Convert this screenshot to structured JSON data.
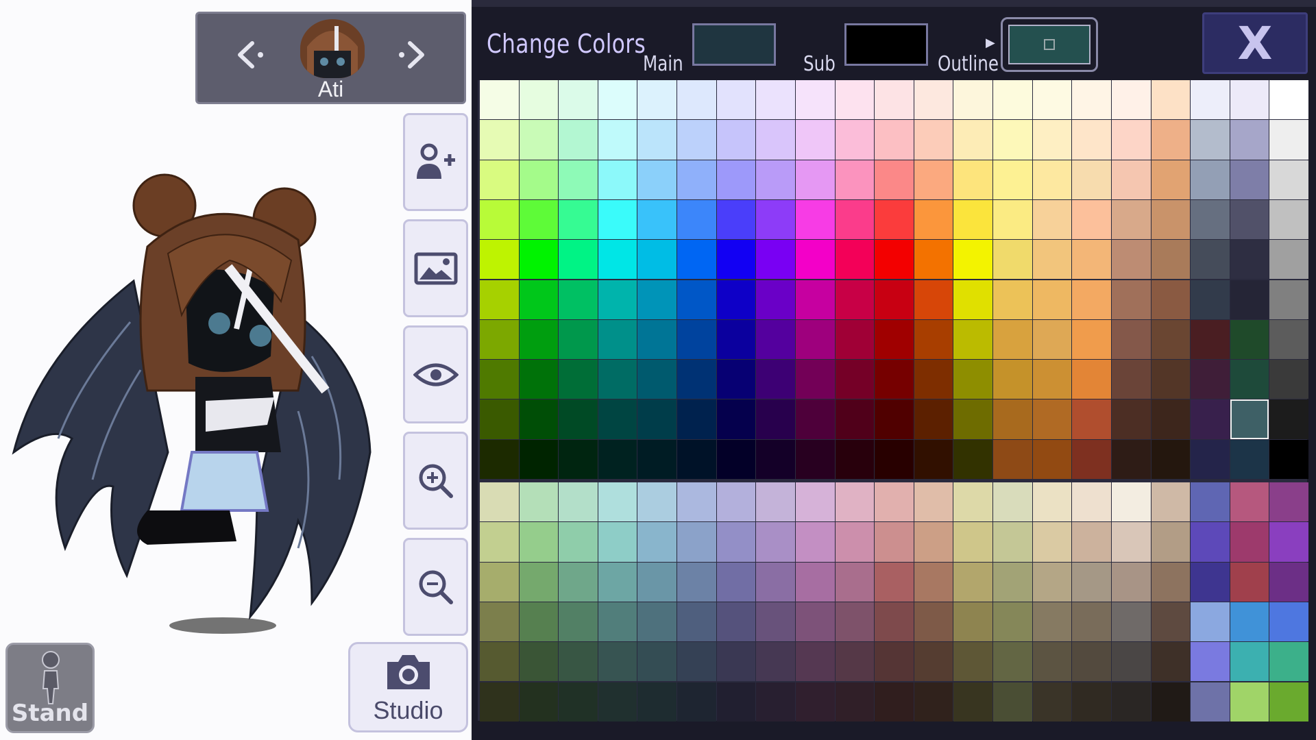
{
  "character": {
    "name": "Ati"
  },
  "panel": {
    "title": "Change Colors",
    "main_label": "Main",
    "sub_label": "Sub",
    "outline_label": "Outline",
    "close_label": "X",
    "main_color": "#1f3540",
    "sub_color": "#000000",
    "outline_color": "#24504f"
  },
  "buttons": {
    "stand_label": "Stand",
    "studio_label": "Studio"
  },
  "palette": {
    "top_grid": [
      [
        "#f5fde6",
        "#e6fde0",
        "#dbfbe9",
        "#dcfdfc",
        "#dcf2fd",
        "#dde8fd",
        "#e2e2fd",
        "#ebe2fd",
        "#f6e3fb",
        "#fde2ef",
        "#fde3e5",
        "#fde8df",
        "#fdf6dc",
        "#fdfbdd",
        "#fefae3",
        "#fff5e6",
        "#fff1e8",
        "#fde1c6",
        "#edeefa",
        "#edeaf9",
        "#ffffff"
      ],
      [
        "#e6fbb4",
        "#c9fbb7",
        "#b3f7d2",
        "#bffafb",
        "#bbe4fb",
        "#bcd1fb",
        "#c6c4fb",
        "#d9c5fb",
        "#efc6f8",
        "#fbbdd9",
        "#fcbfc3",
        "#fcccb9",
        "#fdecb6",
        "#fdf8b9",
        "#feefc3",
        "#fee5c9",
        "#fdd5c7",
        "#eeb088",
        "#b3bccc",
        "#a6a6c9",
        "#eeeeee"
      ],
      [
        "#d9fb80",
        "#a4fb8a",
        "#8efab7",
        "#8cf9fa",
        "#8bd0fa",
        "#8fb0fa",
        "#9d99fa",
        "#b99bf8",
        "#e598f3",
        "#fb93be",
        "#fb8888",
        "#fba97f",
        "#fde47c",
        "#fdf193",
        "#fde8a0",
        "#f7dcae",
        "#f5c6b0",
        "#e1a372",
        "#939fb5",
        "#7e7ea8",
        "#d8d8d8"
      ],
      [
        "#b8fb38",
        "#5efb38",
        "#36fb93",
        "#3afbfa",
        "#39c2fa",
        "#3c86fa",
        "#4a3efa",
        "#8d3cf8",
        "#f73ce5",
        "#fb3c8b",
        "#fb3c3c",
        "#fb963c",
        "#fbe43c",
        "#fbeb83",
        "#f7d199",
        "#fcc09b",
        "#d8a98a",
        "#c9936a",
        "#666f80",
        "#515169",
        "#c0c0c0"
      ],
      [
        "#bef301",
        "#00f300",
        "#00f385",
        "#00e6e6",
        "#00bde5",
        "#0066f3",
        "#1200f3",
        "#7900f3",
        "#f300c8",
        "#f30058",
        "#f30000",
        "#f37200",
        "#f3f300",
        "#f0da6b",
        "#f2c57c",
        "#f3b677",
        "#bd8c73",
        "#a97b5a",
        "#454c5a",
        "#2e2e42",
        "#a0a0a0"
      ],
      [
        "#a6d100",
        "#00c71a",
        "#00c063",
        "#00b4ac",
        "#0094b8",
        "#0057c7",
        "#0e00c7",
        "#6a00c7",
        "#c600a0",
        "#c80046",
        "#c80012",
        "#d74608",
        "#e0e000",
        "#ecc258",
        "#eeb862",
        "#f3a962",
        "#a0705a",
        "#8a5a42",
        "#323b4b",
        "#252536",
        "#808080"
      ],
      [
        "#7ca800",
        "#009e0f",
        "#00984c",
        "#00908a",
        "#007596",
        "#00439e",
        "#0b009e",
        "#54009e",
        "#9e007d",
        "#a00036",
        "#a00000",
        "#a83e00",
        "#bbbb00",
        "#d8a23e",
        "#dea855",
        "#f09c4c",
        "#84584a",
        "#6a4632",
        "#4a1e22",
        "#1f4a2a",
        "#5c5c5c"
      ],
      [
        "#4f7a00",
        "#007209",
        "#006e37",
        "#006c64",
        "#005a6e",
        "#003274",
        "#070073",
        "#3d0074",
        "#730057",
        "#750027",
        "#760000",
        "#7e2e00",
        "#8e8e00",
        "#c5922a",
        "#cc9033",
        "#e38536",
        "#6a4438",
        "#533627",
        "#3f1e38",
        "#1e4a3a",
        "#3a3a3a"
      ],
      [
        "#3a5a00",
        "#004e06",
        "#004a25",
        "#004542",
        "#003d4a",
        "#00224e",
        "#05004d",
        "#28004d",
        "#4e003a",
        "#50001a",
        "#500000",
        "#5c2000",
        "#6e6c00",
        "#a86a1e",
        "#b06a24",
        "#b04e2e",
        "#4c2e24",
        "#3d261c",
        "#38204c",
        "#3e6066",
        "#1c1c1c"
      ],
      [
        "#1c2a00",
        "#002400",
        "#002510",
        "#002220",
        "#001c24",
        "#001228",
        "#030028",
        "#140028",
        "#280020",
        "#28000c",
        "#280000",
        "#311000",
        "#323200",
        "#8e4a16",
        "#924a12",
        "#7e3020",
        "#2e1c16",
        "#24170e",
        "#24244a",
        "#1c3448",
        "#000000"
      ]
    ],
    "bottom_grid": [
      [
        "#d9dcb4",
        "#b4dfb8",
        "#b3dfc9",
        "#afdfdd",
        "#abcde0",
        "#abb8df",
        "#b3b0dc",
        "#c4b3d9",
        "#d6b2d8",
        "#e0b2c4",
        "#e1b0ae",
        "#e0bda9",
        "#ddd9a8",
        "#d9dcbb",
        "#ebe1c4",
        "#eee0cf",
        "#f3ede1",
        "#cfb9a6",
        "#5f66b3",
        "#b6587e",
        "#8a3f8a"
      ],
      [
        "#c2cf90",
        "#95cd8c",
        "#8fcdaa",
        "#8ecdc7",
        "#89b5cc",
        "#8ba2c9",
        "#938fc7",
        "#a98fc6",
        "#c38fc3",
        "#cc8fac",
        "#cc8f8f",
        "#cc9f86",
        "#cfc68a",
        "#c4c796",
        "#dacaa3",
        "#ccb29d",
        "#d9c6b8",
        "#b29d86",
        "#5d49b9",
        "#9d3a6c",
        "#8a3fbf"
      ],
      [
        "#a6ad6c",
        "#75a96d",
        "#6fa78a",
        "#6da6a4",
        "#6a96a7",
        "#6c82a6",
        "#716ea5",
        "#8a6ea4",
        "#a76ea2",
        "#a96e8d",
        "#a96062",
        "#a87862",
        "#b2a66c",
        "#a2a376",
        "#b4a686",
        "#a59886",
        "#a89486",
        "#8d735f",
        "#3e3590",
        "#a0404c",
        "#6c2f86"
      ],
      [
        "#7c7f4c",
        "#568050",
        "#528065",
        "#517e7b",
        "#4e717d",
        "#4f5f7e",
        "#55527c",
        "#68527b",
        "#7d5279",
        "#7e526a",
        "#7e4a4c",
        "#7e5a48",
        "#8e8450",
        "#858759",
        "#867a62",
        "#796c5a",
        "#6f6a68",
        "#5e4a40",
        "#8ba8e0",
        "#4092d8",
        "#4e77e0"
      ],
      [
        "#565a30",
        "#3a5536",
        "#385644",
        "#375452",
        "#344d54",
        "#354155",
        "#3a3853",
        "#463853",
        "#553852",
        "#553847",
        "#553535",
        "#553d31",
        "#5e5736",
        "#636644",
        "#5c5442",
        "#534a3e",
        "#4a4645",
        "#3e3028",
        "#7a7ae0",
        "#3cb0b0",
        "#3cb08a"
      ],
      [
        "#2f321c",
        "#23311f",
        "#203126",
        "#20302f",
        "#1e2c30",
        "#1e2531",
        "#211f30",
        "#281f30",
        "#301f2e",
        "#301f28",
        "#301e1e",
        "#30221c",
        "#383520",
        "#4a4e34",
        "#3a3428",
        "#302a22",
        "#2a2624",
        "#201a16",
        "#6e72a8",
        "#a0d468",
        "#6aaa2e"
      ]
    ],
    "selected_cell": [
      8,
      19
    ]
  }
}
